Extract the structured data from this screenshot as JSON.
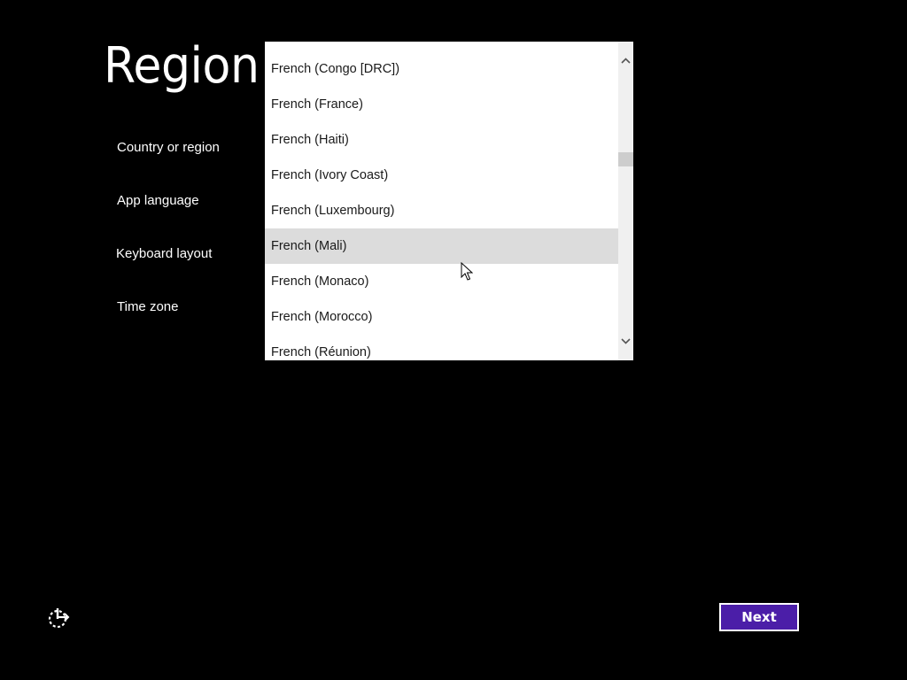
{
  "page": {
    "title": "Region"
  },
  "nav": {
    "items": [
      {
        "label": "Country or region"
      },
      {
        "label": "App language"
      },
      {
        "label": "Keyboard layout"
      },
      {
        "label": "Time zone"
      }
    ]
  },
  "dropdown": {
    "highlighted": "French (Mali)",
    "items": [
      {
        "label": "French (Congo [DRC])"
      },
      {
        "label": "French (France)"
      },
      {
        "label": "French (Haiti)"
      },
      {
        "label": "French (Ivory Coast)"
      },
      {
        "label": "French (Luxembourg)"
      },
      {
        "label": "French (Mali)"
      },
      {
        "label": "French (Monaco)"
      },
      {
        "label": "French (Morocco)"
      },
      {
        "label": "French (Réunion)"
      }
    ]
  },
  "footer": {
    "next_label": "Next",
    "ease_icon": "ease-of-access-icon"
  },
  "colors": {
    "background": "#000000",
    "accent": "#4b1ea8",
    "list_hover": "#dcdcdc"
  }
}
